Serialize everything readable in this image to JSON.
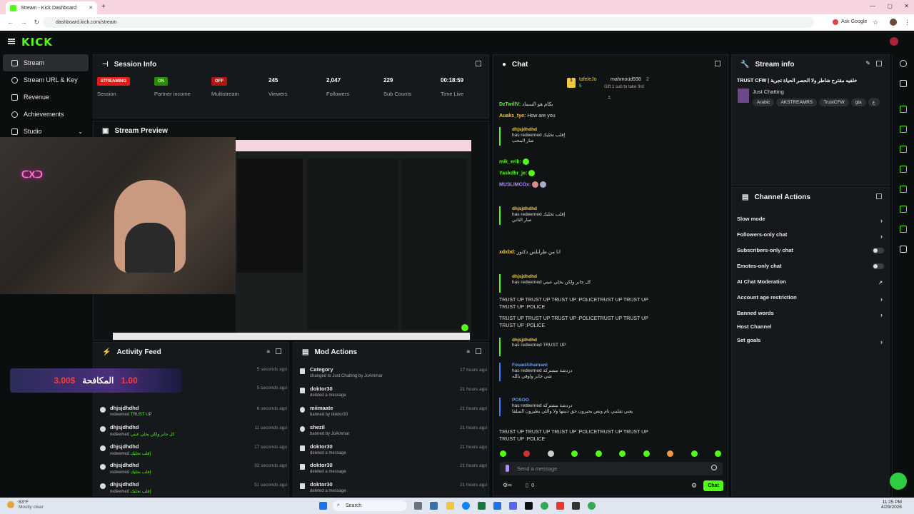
{
  "browser": {
    "tab_title": "Stream - Kick Dashboard",
    "url": "dashboard.kick.com/stream",
    "ask_google": "Ask Google"
  },
  "app": {
    "logo": "KICK"
  },
  "sidebar": {
    "items": [
      {
        "label": "Stream"
      },
      {
        "label": "Stream URL & Key"
      },
      {
        "label": "Revenue"
      },
      {
        "label": "Achievements"
      },
      {
        "label": "Studio"
      }
    ]
  },
  "session": {
    "title": "Session Info",
    "stats": [
      {
        "value": "STREAMING",
        "label": "Session"
      },
      {
        "value": "ON",
        "label": "Partner income"
      },
      {
        "value": "OFF",
        "label": "Multistream"
      },
      {
        "value": "245",
        "label": "Viewers"
      },
      {
        "value": "2,047",
        "label": "Followers"
      },
      {
        "value": "229",
        "label": "Sub Counts"
      },
      {
        "value": "00:18:59",
        "label": "Time Live"
      }
    ]
  },
  "preview": {
    "title": "Stream Preview"
  },
  "activity": {
    "title": "Activity Feed",
    "items": [
      {
        "user": "",
        "action": "",
        "time": "5 seconds ago"
      },
      {
        "user": "",
        "action": "",
        "time": "5 seconds ago"
      },
      {
        "user": "dhjsjdhdhd",
        "action": "redeemed",
        "reward": "TRUST UP",
        "time": "6 seconds ago"
      },
      {
        "user": "dhjsjdhdhd",
        "action": "redeemed",
        "reward": "كل جابر ولكن يخلي عيني",
        "time": "11 seconds ago"
      },
      {
        "user": "dhjsjdhdhd",
        "action": "redeemed",
        "reward": "إقلب تخليك",
        "time": "17 seconds ago"
      },
      {
        "user": "dhjsjdhdhd",
        "action": "redeemed",
        "reward": "إقلب تخليك",
        "time": "32 seconds ago"
      },
      {
        "user": "dhjsjdhdhd",
        "action": "redeemed",
        "reward": "إقلب تخليك",
        "time": "51 seconds ago"
      }
    ],
    "overlay_text": "المكافحة",
    "overlay_left": "3.00$",
    "overlay_right": "1.00"
  },
  "mod": {
    "title": "Mod Actions",
    "items": [
      {
        "user": "Category",
        "action": "changed to Just Chatting by JoAmmar",
        "time": "17 hours ago"
      },
      {
        "user": "doktor30",
        "action": "deleted a message",
        "time": "21 hours ago"
      },
      {
        "user": "miimaate",
        "action": "banned by doktor30",
        "time": "21 hours ago"
      },
      {
        "user": "shezil",
        "action": "banned by JoAmmar",
        "time": "21 hours ago"
      },
      {
        "user": "doktor30",
        "action": "deleted a message",
        "time": "21 hours ago"
      },
      {
        "user": "doktor30",
        "action": "deleted a message",
        "time": "21 hours ago"
      },
      {
        "user": "doktor30",
        "action": "deleted a message",
        "time": "21 hours ago"
      }
    ]
  },
  "chat": {
    "title": "Chat",
    "pinned_user1": "tafeleJo",
    "pinned_user1_count": "5",
    "pinned_user2": "mahmoud938",
    "pinned_count": "2",
    "pinned_sub": "Gift 1 sub to take 3rd",
    "messages": [
      {
        "user": "DzTwillV:",
        "text": "بكام هو السماد",
        "color": "#53fc18"
      },
      {
        "user": "Auaks_tye:",
        "text": "How are you",
        "color": "#f2c744"
      },
      {
        "user": "mik_erik:",
        "text": "",
        "color": "#53fc18"
      },
      {
        "user": "Yaskdhr_je:",
        "text": "",
        "color": "#53fc18"
      },
      {
        "user": "MUSLIMCOx:",
        "text": "",
        "color": "#b18cff"
      },
      {
        "user": "xdxbd:",
        "text": "انا من طرابلس دكتور",
        "color": "#f2c744"
      }
    ],
    "redeems": [
      {
        "user": "dhjsjdhdhd",
        "line": "has redeemed إقلب تخليك",
        "sub": "صار المحب"
      },
      {
        "user": "dhjsjdhdhd",
        "line": "has redeemed إقلب تخليك",
        "sub": "صار الثاني"
      },
      {
        "user": "dhjsjdhdhd",
        "line": "has redeemed كل جابر ولكن يخلي عيني",
        "sub": ""
      },
      {
        "user": "dhjsjdhdhd",
        "line": "has redeemed TRUST UP",
        "sub": ""
      },
      {
        "user": "FouadAlhamawi",
        "line": "has redeemed دردشة مشتركة",
        "sub": "شي جابر واوقي بالله"
      },
      {
        "user": "POSOO",
        "line": "has redeemed دردشة مشتركة",
        "sub": "يعني تقلبني نام ونص يحيرون حق دنيتها ولا واللي يطيرون السلفا"
      }
    ],
    "trust_line1": "TRUST UP  TRUST UP  TRUST UP  :POLICETRUST UP  TRUST UP",
    "trust_line2": "TRUST UP  :POLICE",
    "input_placeholder": "Send a message",
    "viewer_count": "0",
    "send_button": "Chat"
  },
  "stream_info": {
    "title": "Stream info",
    "stream_title": "TRUST CFW | خلفيه مقترح شاطر ولا الحصر الحياة تجربة",
    "category": "Just Chatting",
    "tags": [
      "Arabic",
      "AKSTREAMRS",
      "TrustCFW",
      "gta",
      "ﻉ"
    ]
  },
  "channel_actions": {
    "title": "Channel Actions",
    "items": [
      {
        "label": "Slow mode",
        "control": "chevron"
      },
      {
        "label": "Followers-only chat",
        "control": "chevron"
      },
      {
        "label": "Subscribers-only chat",
        "control": "toggle"
      },
      {
        "label": "Emotes-only chat",
        "control": "toggle"
      },
      {
        "label": "AI Chat Moderation",
        "control": "external"
      },
      {
        "label": "Account age restriction",
        "control": "chevron"
      },
      {
        "label": "Banned words",
        "control": "chevron"
      },
      {
        "label": "Host Channel",
        "control": "none"
      },
      {
        "label": "Set goals",
        "control": "chevron"
      }
    ]
  },
  "taskbar": {
    "weather_temp": "63°F",
    "weather_desc": "Mostly clear",
    "search": "Search",
    "time": "11:25 PM",
    "date": "4/29/2026"
  },
  "colors": {
    "accent": "#53fc18",
    "streaming": "#e91916",
    "on": "#53fc18",
    "off": "#e91916"
  }
}
